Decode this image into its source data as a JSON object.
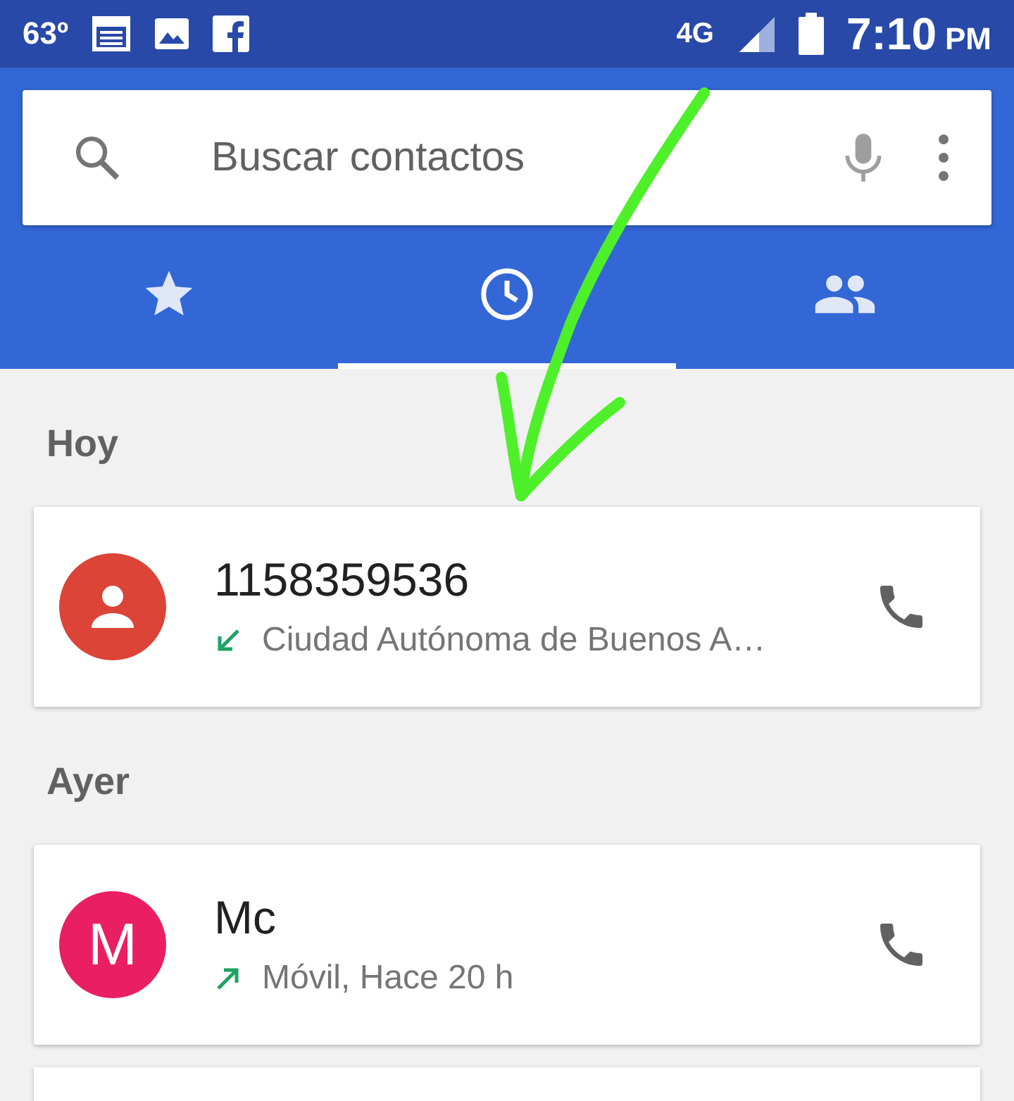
{
  "status_bar": {
    "temperature": "63º",
    "network": "4G",
    "time": "7:10",
    "am_pm": "PM"
  },
  "search": {
    "placeholder": "Buscar contactos"
  },
  "tabs": [
    {
      "kind": "favorites",
      "selected": false
    },
    {
      "kind": "recents",
      "selected": true
    },
    {
      "kind": "contacts",
      "selected": false
    }
  ],
  "sections": [
    {
      "heading": "Hoy",
      "calls": [
        {
          "number": "1158359536",
          "avatar": {
            "kind": "silhouette",
            "color": "#db4437"
          },
          "kind": "incoming",
          "detail": "Ciudad Autónoma de Buenos A…"
        }
      ]
    },
    {
      "heading": "Ayer",
      "calls": [
        {
          "number": "Mc",
          "avatar": {
            "kind": "letter",
            "letter": "M",
            "color": "#e91e63"
          },
          "kind": "outgoing",
          "detail": "Móvil, Hace 20 h"
        }
      ]
    }
  ]
}
